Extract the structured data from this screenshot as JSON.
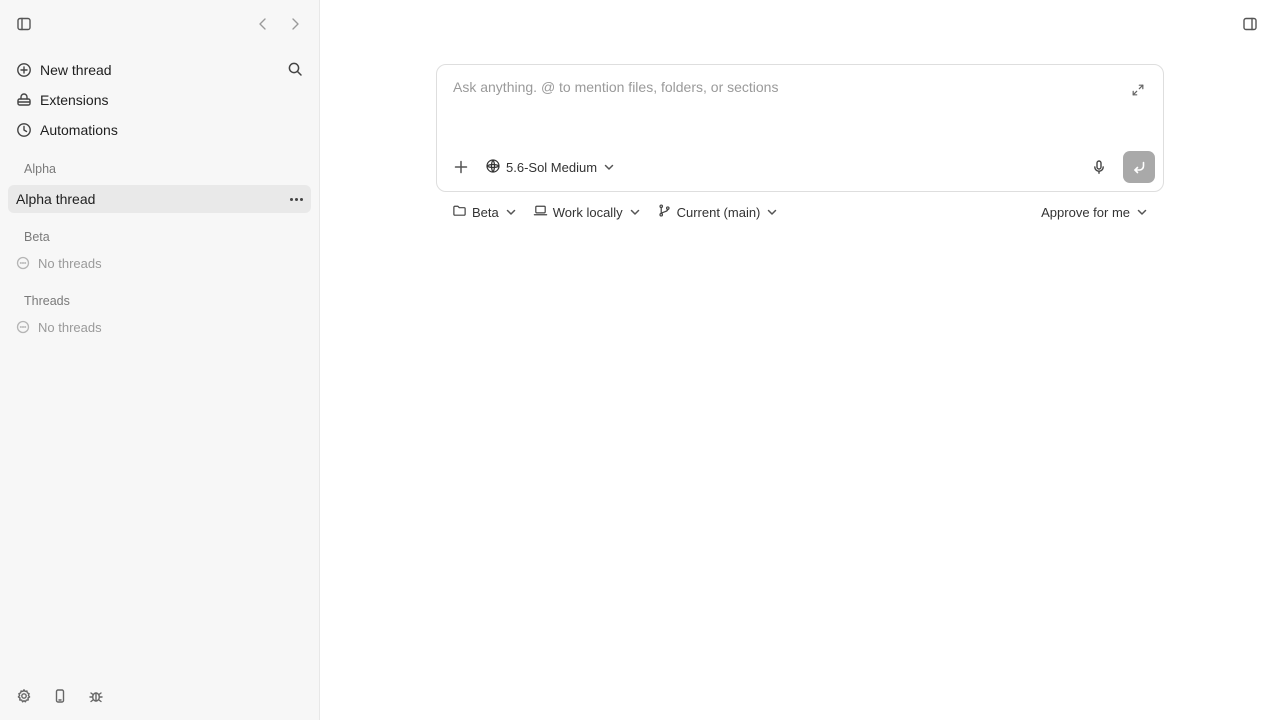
{
  "sidebar": {
    "nav": [
      {
        "label": "New thread",
        "icon": "plus-circle-icon"
      },
      {
        "label": "Extensions",
        "icon": "extensions-icon"
      },
      {
        "label": "Automations",
        "icon": "clock-icon"
      }
    ],
    "sections": [
      {
        "title": "Alpha",
        "threads": [
          "Alpha thread"
        ],
        "empty": ""
      },
      {
        "title": "Beta",
        "threads": [],
        "empty": "No threads"
      },
      {
        "title": "Threads",
        "threads": [],
        "empty": "No threads"
      }
    ]
  },
  "composer": {
    "placeholder": "Ask anything. @ to mention files, folders, or sections",
    "value": "",
    "model": "5.6-Sol Medium"
  },
  "options": {
    "project": "Beta",
    "location": "Work locally",
    "branch": "Current (main)",
    "approval": "Approve for me"
  },
  "colors": {
    "sidebar_bg": "#f7f7f7",
    "active_item_bg": "#e9e9e9",
    "send_button_disabled": "#a9a9a9"
  }
}
